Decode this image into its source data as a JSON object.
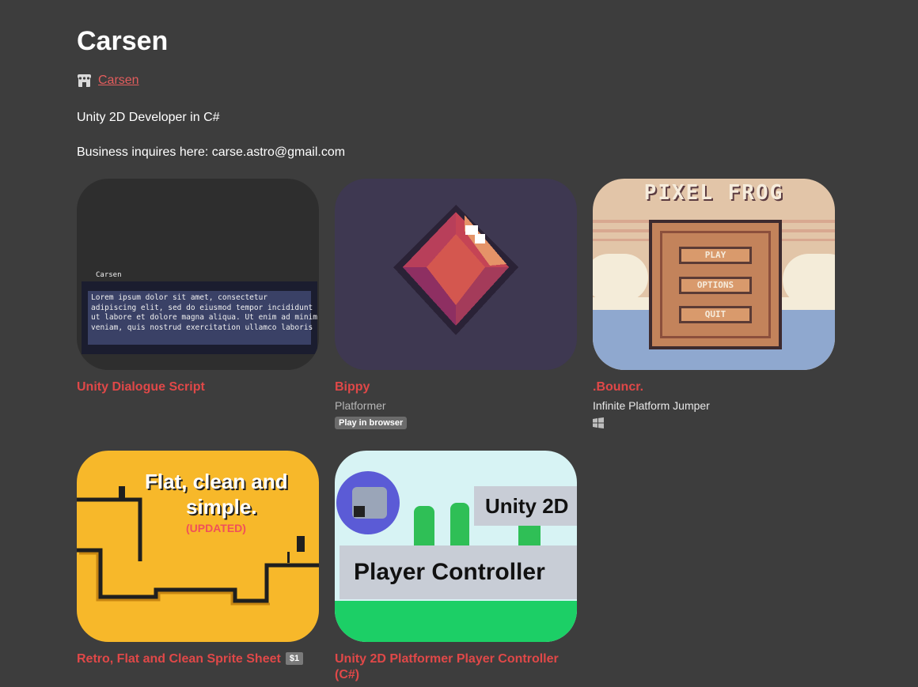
{
  "profile": {
    "title": "Carsen",
    "user_link": "Carsen",
    "bio_line1": "Unity 2D Developer in C#",
    "bio_line2": "Business inquires here: carse.astro@gmail.com"
  },
  "games": [
    {
      "title": "Unity Dialogue Script",
      "thumb_text": {
        "speaker": "Carsen",
        "lines": [
          "Lorem ipsum dolor sit amet, consectetur",
          "adipiscing elit, sed do eiusmod tempor incididunt",
          "ut labore et dolore magna aliqua. Ut enim ad minim",
          "veniam, quis nostrud exercitation ullamco laboris"
        ]
      }
    },
    {
      "title": "Bippy",
      "subtitle": "Platformer",
      "badge": "Play in browser"
    },
    {
      "title": ".Bouncr.",
      "subtitle": "Infinite Platform Jumper",
      "platform_icon": "windows-icon",
      "thumb_text": {
        "logo": "PIXEL FROG",
        "buttons": [
          "PLAY",
          "OPTIONS",
          "QUIT"
        ]
      }
    },
    {
      "title": "Retro, Flat and Clean Sprite Sheet",
      "price": "$1",
      "thumb_text": {
        "line1": "Flat, clean and",
        "line2": "simple.",
        "line3": "(UPDATED)"
      }
    },
    {
      "title": "Unity 2D Platformer Player Controller (C#)",
      "thumb_text": {
        "top": "Unity 2D",
        "main": "Player Controller"
      }
    }
  ],
  "colors": {
    "background": "#3d3d3d",
    "link": "#e35d5d",
    "game_title": "#e04848"
  }
}
